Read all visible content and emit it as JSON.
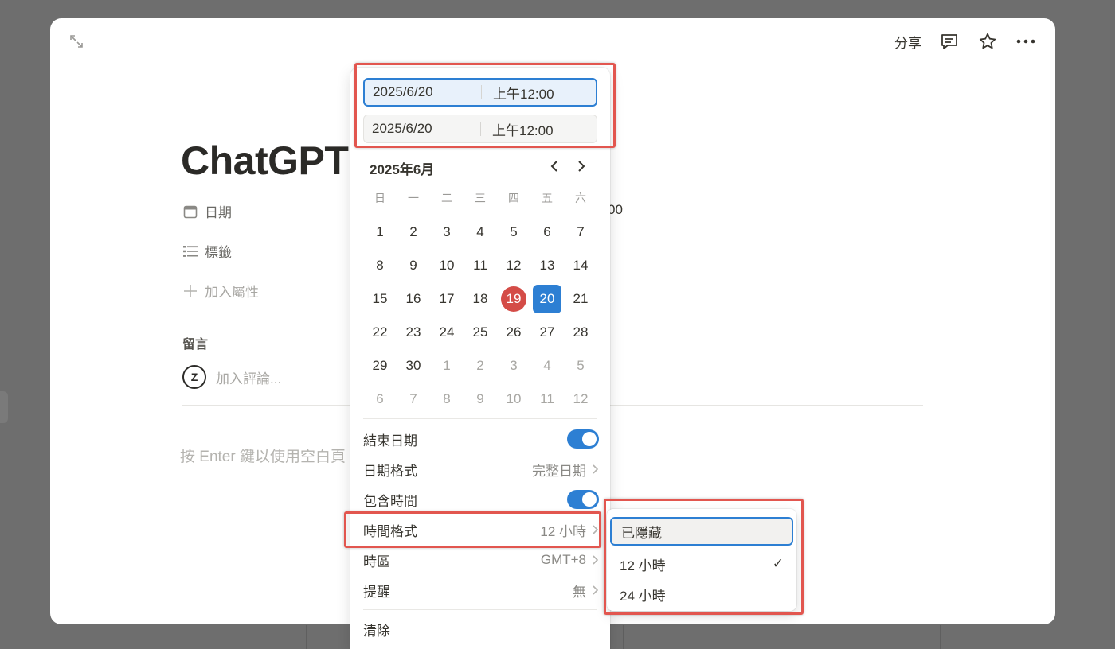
{
  "window": {
    "share_label": "分享"
  },
  "page": {
    "title": "ChatGPT",
    "properties": {
      "date_label": "日期",
      "date_value_tail": "00",
      "tags_label": "標籤",
      "add_property_label": "加入屬性"
    },
    "comments": {
      "heading": "留言",
      "avatar_letter": "Z",
      "placeholder": "加入評論..."
    },
    "empty_hint": "按 Enter 鍵以使用空白頁"
  },
  "date_picker": {
    "start": {
      "date": "2025/6/20",
      "time": "上午12:00"
    },
    "end": {
      "date": "2025/6/20",
      "time": "上午12:00"
    },
    "month_label": "2025年6月",
    "weekdays": [
      "日",
      "一",
      "二",
      "三",
      "四",
      "五",
      "六"
    ],
    "today": 19,
    "selected": 20,
    "weeks": [
      [
        1,
        2,
        3,
        4,
        5,
        6,
        7
      ],
      [
        8,
        9,
        10,
        11,
        12,
        13,
        14
      ],
      [
        15,
        16,
        17,
        18,
        19,
        20,
        21
      ],
      [
        22,
        23,
        24,
        25,
        26,
        27,
        28
      ],
      [
        29,
        30,
        1,
        2,
        3,
        4,
        5
      ],
      [
        6,
        7,
        8,
        9,
        10,
        11,
        12
      ]
    ],
    "options": {
      "end_date": {
        "label": "結束日期",
        "enabled": true
      },
      "date_format": {
        "label": "日期格式",
        "value": "完整日期"
      },
      "include_time": {
        "label": "包含時間",
        "enabled": true
      },
      "time_format": {
        "label": "時間格式",
        "value": "12 小時"
      },
      "timezone": {
        "label": "時區",
        "value": "GMT+8"
      },
      "reminder": {
        "label": "提醒",
        "value": "無"
      },
      "clear": {
        "label": "清除"
      }
    }
  },
  "time_format_menu": {
    "items": [
      {
        "label": "已隱藏",
        "checked": false
      },
      {
        "label": "12 小時",
        "checked": true,
        "check_mark": "✓"
      },
      {
        "label": "24 小時",
        "checked": false
      }
    ]
  },
  "colors": {
    "accent": "#2d7fd3",
    "today": "#d44c47",
    "annotation": "#e2564f"
  }
}
